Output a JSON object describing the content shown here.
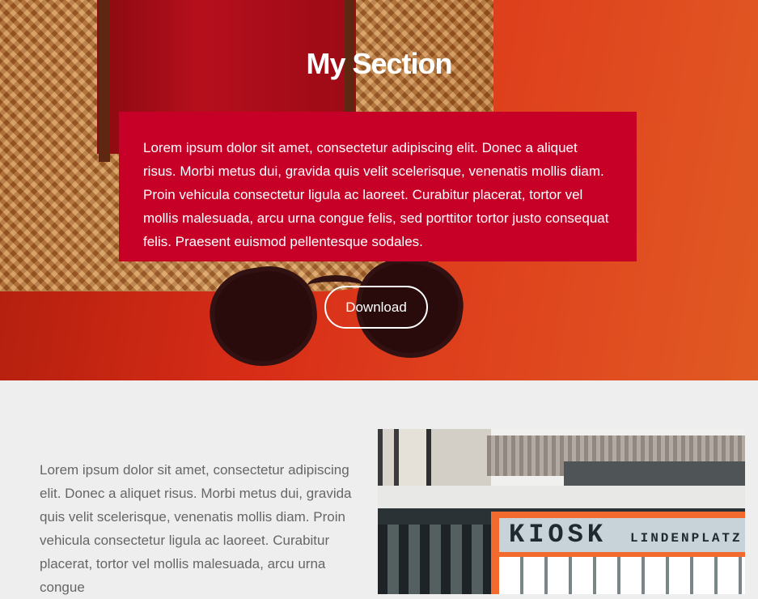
{
  "hero": {
    "title": "My Section",
    "description": "Lorem ipsum dolor sit amet, consectetur adipiscing elit. Donec a aliquet risus. Morbi metus dui, gravida quis velit scelerisque, venenatis mollis diam. Proin vehicula consectetur ligula ac laoreet. Curabitur placerat, tortor vel mollis malesuada, arcu urna congue felis, sed porttitor tortor justo consequat felis. Praesent euismod pellentesque sodales.",
    "button_label": "Download",
    "box_color": "#c70028"
  },
  "content": {
    "text": "Lorem ipsum dolor sit amet, consectetur adipiscing elit. Donec a aliquet risus. Morbi metus dui, gravida quis velit scelerisque, venenatis mollis diam. Proin vehicula consectetur ligula ac laoreet. Curabitur placerat, tortor vel mollis malesuada, arcu urna congue",
    "sign_main": "KIOSK",
    "sign_sub": "LINDENPLATZ"
  }
}
